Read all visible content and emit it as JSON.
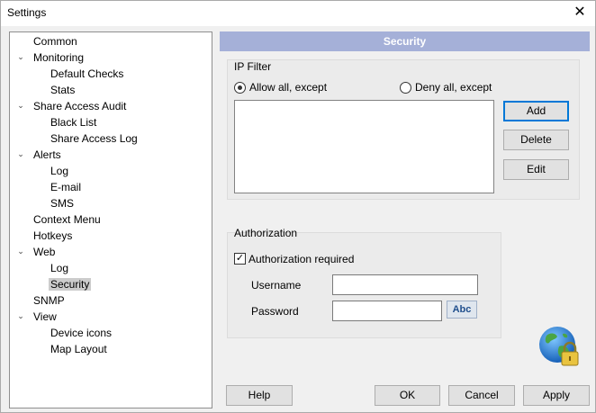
{
  "window": {
    "title": "Settings",
    "close_glyph": "✕"
  },
  "tree": {
    "items": [
      {
        "label": "Common",
        "level": 0,
        "expandable": false
      },
      {
        "label": "Monitoring",
        "level": 0,
        "expandable": true
      },
      {
        "label": "Default Checks",
        "level": 1,
        "expandable": false
      },
      {
        "label": "Stats",
        "level": 1,
        "expandable": false
      },
      {
        "label": "Share Access Audit",
        "level": 0,
        "expandable": true
      },
      {
        "label": "Black List",
        "level": 1,
        "expandable": false
      },
      {
        "label": "Share Access Log",
        "level": 1,
        "expandable": false
      },
      {
        "label": "Alerts",
        "level": 0,
        "expandable": true
      },
      {
        "label": "Log",
        "level": 1,
        "expandable": false
      },
      {
        "label": "E-mail",
        "level": 1,
        "expandable": false
      },
      {
        "label": "SMS",
        "level": 1,
        "expandable": false
      },
      {
        "label": "Context Menu",
        "level": 0,
        "expandable": false
      },
      {
        "label": "Hotkeys",
        "level": 0,
        "expandable": false
      },
      {
        "label": "Web",
        "level": 0,
        "expandable": true
      },
      {
        "label": "Log",
        "level": 1,
        "expandable": false
      },
      {
        "label": "Security",
        "level": 1,
        "expandable": false,
        "selected": true
      },
      {
        "label": "SNMP",
        "level": 0,
        "expandable": false
      },
      {
        "label": "View",
        "level": 0,
        "expandable": true
      },
      {
        "label": "Device icons",
        "level": 1,
        "expandable": false
      },
      {
        "label": "Map Layout",
        "level": 1,
        "expandable": false
      }
    ]
  },
  "panel": {
    "header": "Security",
    "ip_filter": {
      "title": "IP Filter",
      "allow_label": "Allow all, except",
      "deny_label": "Deny all, except",
      "selected": "allow",
      "buttons": {
        "add": "Add",
        "delete": "Delete",
        "edit": "Edit"
      }
    },
    "authorization": {
      "title": "Authorization",
      "required_label": "Authorization required",
      "required_checked": true,
      "username_label": "Username",
      "username_value": "",
      "password_label": "Password",
      "password_value": "",
      "abc_label": "Abc"
    }
  },
  "footer": {
    "help": "Help",
    "ok": "OK",
    "cancel": "Cancel",
    "apply": "Apply"
  },
  "colors": {
    "header_bar": "#a5b0d8",
    "accent": "#0078d7"
  }
}
